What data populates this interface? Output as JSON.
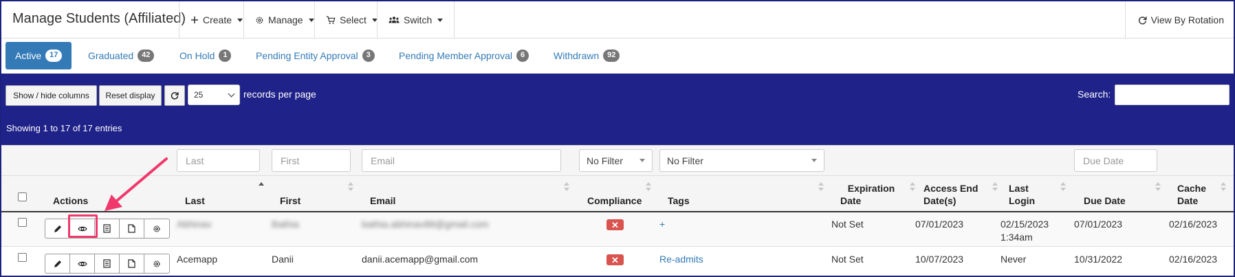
{
  "header": {
    "title": "Manage Students (Affiliated)",
    "menus": [
      {
        "label": "Create",
        "icon": "plus-icon"
      },
      {
        "label": "Manage",
        "icon": "gear-icon"
      },
      {
        "label": "Select",
        "icon": "cart-icon"
      },
      {
        "label": "Switch",
        "icon": "users-icon"
      }
    ],
    "view_by_rotation": "View By Rotation"
  },
  "tabs": [
    {
      "label": "Active",
      "count": "17",
      "active": true
    },
    {
      "label": "Graduated",
      "count": "42"
    },
    {
      "label": "On Hold",
      "count": "1"
    },
    {
      "label": "Pending Entity Approval",
      "count": "3"
    },
    {
      "label": "Pending Member Approval",
      "count": "6"
    },
    {
      "label": "Withdrawn",
      "count": "92"
    }
  ],
  "toolbar": {
    "show_hide_columns": "Show / hide columns",
    "reset_display": "Reset display",
    "per_page_value": "25",
    "per_page_label": "records per page",
    "search_label": "Search:",
    "showing": "Showing 1 to 17 of 17 entries"
  },
  "filters": {
    "last_placeholder": "Last",
    "first_placeholder": "First",
    "email_placeholder": "Email",
    "compliance_filter": "No Filter",
    "tags_filter": "No Filter",
    "due_date_placeholder": "Due Date"
  },
  "columns": {
    "actions": "Actions",
    "last": "Last",
    "first": "First",
    "email": "Email",
    "compliance": "Compliance",
    "tags": "Tags",
    "expiration_line1": "Expiration",
    "expiration_line2": "Date",
    "access_end_line1": "Access End",
    "access_end_line2": "Date(s)",
    "last_login_line1": "Last",
    "last_login_line2": "Login",
    "due_date": "Due Date",
    "cache_line1": "Cache",
    "cache_line2": "Date"
  },
  "rows": [
    {
      "last": "Abhinav",
      "first": "Bathia",
      "email": "bathia.abhinav88@gmail.com",
      "compliance": "✕",
      "tags": "+",
      "expiration": "Not Set",
      "access_end": "07/01/2023",
      "last_login_line1": "02/15/2023",
      "last_login_line2": "1:34am",
      "due_date": "07/01/2023",
      "cache_date": "02/16/2023"
    },
    {
      "last": "Acemapp",
      "first": "Danii",
      "email": "danii.acemapp@gmail.com",
      "compliance": "✕",
      "tags": "Re-admits",
      "expiration": "Not Set",
      "access_end": "10/07/2023",
      "last_login_line1": "Never",
      "last_login_line2": "",
      "due_date": "10/31/2022",
      "cache_date": "02/16/2023"
    }
  ],
  "colors": {
    "toolbar_bg": "#1f2288",
    "primary": "#337ab7",
    "danger": "#d9534f",
    "annotation": "#f0386b"
  }
}
